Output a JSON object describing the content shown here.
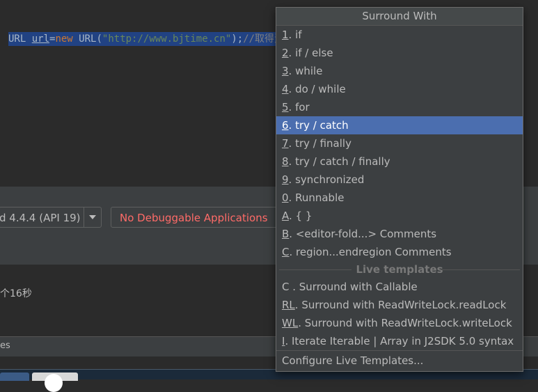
{
  "editor": {
    "code": {
      "t1": "URL ",
      "t2": "url",
      "t3": "=",
      "t4": "new",
      "t5": " URL(",
      "t6": "\"http://www.bjtime.cn\"",
      "t7": ");",
      "t8": "//取得资"
    }
  },
  "device_bar": {
    "device_label": "d 4.4.4 (API 19)",
    "debug_label": "No Debuggable Applications"
  },
  "log": {
    "text": "个16秒"
  },
  "status": {
    "text": "es"
  },
  "popup": {
    "title": "Surround With",
    "items": [
      {
        "mnemonic": "1",
        "label": ". if"
      },
      {
        "mnemonic": "2",
        "label": ". if / else"
      },
      {
        "mnemonic": "3",
        "label": ". while"
      },
      {
        "mnemonic": "4",
        "label": ". do / while"
      },
      {
        "mnemonic": "5",
        "label": ". for"
      },
      {
        "mnemonic": "6",
        "label": ". try / catch"
      },
      {
        "mnemonic": "7",
        "label": ". try / finally"
      },
      {
        "mnemonic": "8",
        "label": ". try / catch / finally"
      },
      {
        "mnemonic": "9",
        "label": ". synchronized"
      },
      {
        "mnemonic": "0",
        "label": ". Runnable"
      },
      {
        "mnemonic": "A",
        "label": ". { }"
      },
      {
        "mnemonic": "B",
        "label": ". <editor-fold...> Comments"
      },
      {
        "mnemonic": "C",
        "label": ". region...endregion Comments"
      }
    ],
    "section_label": "Live templates",
    "templates": [
      {
        "mnemonic": "",
        "label": "C . Surround with Callable"
      },
      {
        "mnemonic": "RL",
        "label": ". Surround with ReadWriteLock.readLock"
      },
      {
        "mnemonic": "WL",
        "label": ". Surround with ReadWriteLock.writeLock"
      },
      {
        "mnemonic": "I",
        "label": ". Iterate Iterable | Array in J2SDK 5.0 syntax"
      }
    ],
    "footer": "Configure Live Templates..."
  },
  "colors": {
    "selection": "#4b6eaf",
    "error_text": "#ff6b68",
    "editor_bg": "#2b2b2b",
    "panel_bg": "#3c3f41"
  }
}
